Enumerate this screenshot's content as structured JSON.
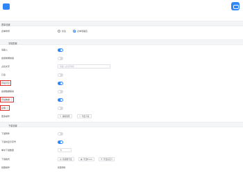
{
  "header": {
    "section1_title": "表单设置",
    "section2_title": "字段配置",
    "section3_title": "下载设置"
  },
  "form_settings": {
    "layout_label": "表单布局",
    "radio_options": [
      {
        "label": "标签",
        "checked": false
      },
      {
        "label": "表单项垂直",
        "checked": true
      }
    ]
  },
  "field_config": {
    "rows": [
      {
        "label": "请输入",
        "type": "toggle",
        "on": true
      },
      {
        "label": "启用前端校验",
        "type": "toggle",
        "on": false
      },
      {
        "label": "占位文字",
        "type": "input",
        "placeholder": "请输入占位符内容"
      },
      {
        "label": "只读",
        "type": "toggle",
        "on": false
      },
      {
        "label": "字段可见",
        "type": "toggle",
        "on": true,
        "highlighted": true
      },
      {
        "label": "启用数据联动",
        "type": "toggle",
        "on": false
      },
      {
        "label": "字段数据 ⓘ",
        "type": "toggle",
        "on": true,
        "highlighted": true
      },
      {
        "label": "必填 ⓘ",
        "type": "toggle",
        "on": false,
        "highlighted": true
      }
    ],
    "actions_label": "更多操作",
    "action_buttons": [
      {
        "icon": "edit-icon",
        "label": "编辑规则"
      },
      {
        "icon": "export-icon",
        "label": "导出字段"
      }
    ]
  },
  "download_settings": {
    "rows": [
      {
        "label": "下载附件",
        "type": "toggle",
        "on": false
      },
      {
        "label": "下载时显示序号",
        "type": "toggle",
        "on": true
      },
      {
        "label": "单次下载数量",
        "type": "number",
        "value": "5"
      }
    ],
    "format_label": "下载格式",
    "format_buttons": [
      {
        "icon": "file-icon",
        "label": "按模板导出"
      },
      {
        "icon": "table-icon",
        "label": "导出Excel"
      },
      {
        "icon": "list-icon",
        "label": "导出自定义"
      }
    ],
    "batch_label": "批量操作",
    "batch_value": "批量删除"
  }
}
